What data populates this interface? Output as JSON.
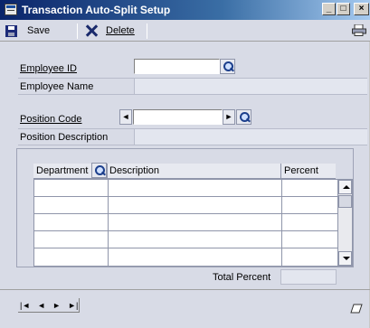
{
  "window": {
    "title": "Transaction Auto-Split Setup",
    "controls": {
      "minimize": "_",
      "maximize": "□",
      "close": "×"
    }
  },
  "toolbar": {
    "save_label": "Save",
    "delete_label": "Delete",
    "icons": [
      "save-icon",
      "delete-icon",
      "print-icon"
    ]
  },
  "form": {
    "employee_id_label": "Employee ID",
    "employee_id_value": "",
    "employee_name_label": "Employee Name",
    "employee_name_value": "",
    "position_code_label": "Position Code",
    "position_code_value": "",
    "position_description_label": "Position Description",
    "position_description_value": ""
  },
  "grid": {
    "columns": [
      "Department",
      "Description",
      "Percent"
    ],
    "rows": [
      [
        "",
        "",
        ""
      ],
      [
        "",
        "",
        ""
      ],
      [
        "",
        "",
        ""
      ],
      [
        "",
        "",
        ""
      ],
      [
        "",
        "",
        ""
      ]
    ],
    "total_label": "Total Percent",
    "total_value": ""
  },
  "navigation": {
    "first": "|◄",
    "prev": "◄",
    "next": "►",
    "last": "►|"
  },
  "colors": {
    "title_gradient_start": "#0a246a",
    "window_background": "#d8dbe6",
    "field_background": "#ffffff"
  }
}
